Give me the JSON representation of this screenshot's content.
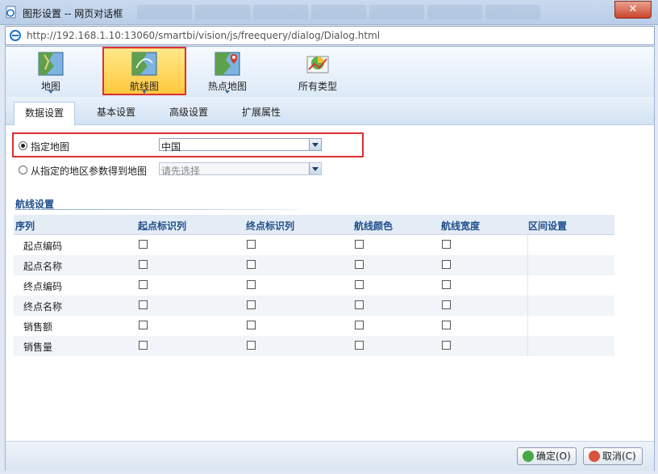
{
  "window": {
    "title": "图形设置 -- 网页对话框",
    "close_glyph": "✕",
    "url_host": "http://192.168.1.10",
    "url_path": ":13060/smartbi/vision/js/freequery/dialog/Dialog.html"
  },
  "chart_types": [
    {
      "label": "地图",
      "icon": "map-icon",
      "active": false,
      "has_menu": true
    },
    {
      "label": "航线图",
      "icon": "route-map-icon",
      "active": true,
      "has_menu": true
    },
    {
      "label": "热点地图",
      "icon": "hotspot-map-icon",
      "active": false,
      "has_menu": true
    },
    {
      "label": "所有类型",
      "icon": "all-types-icon",
      "active": false,
      "has_menu": false
    }
  ],
  "tabs": [
    {
      "label": "数据设置",
      "active": true
    },
    {
      "label": "基本设置",
      "active": false
    },
    {
      "label": "高级设置",
      "active": false
    },
    {
      "label": "扩展属性",
      "active": false
    }
  ],
  "map_source": {
    "specified": {
      "label": "指定地图",
      "selected": true,
      "value": "中国"
    },
    "from_param": {
      "label": "从指定的地区参数得到地图",
      "selected": false,
      "placeholder": "请先选择"
    }
  },
  "route_settings": {
    "section_title": "航线设置",
    "columns": [
      "序列",
      "起点标识列",
      "终点标识列",
      "航线颜色",
      "航线宽度",
      "区间设置"
    ],
    "rows": [
      {
        "name": "起点编码",
        "checks": [
          false,
          false,
          false,
          false
        ]
      },
      {
        "name": "起点名称",
        "checks": [
          false,
          false,
          false,
          false
        ]
      },
      {
        "name": "终点编码",
        "checks": [
          false,
          false,
          false,
          false
        ]
      },
      {
        "name": "终点名称",
        "checks": [
          false,
          false,
          false,
          false
        ]
      },
      {
        "name": "销售额",
        "checks": [
          false,
          false,
          false,
          false
        ]
      },
      {
        "name": "销售量",
        "checks": [
          false,
          false,
          false,
          false
        ]
      }
    ]
  },
  "footer": {
    "ok_label": "确定(O)",
    "cancel_label": "取消(C)"
  },
  "colors": {
    "highlight_border": "#d93030",
    "active_type_bg": "#ffc83d",
    "header_text": "#1f4e8c"
  }
}
